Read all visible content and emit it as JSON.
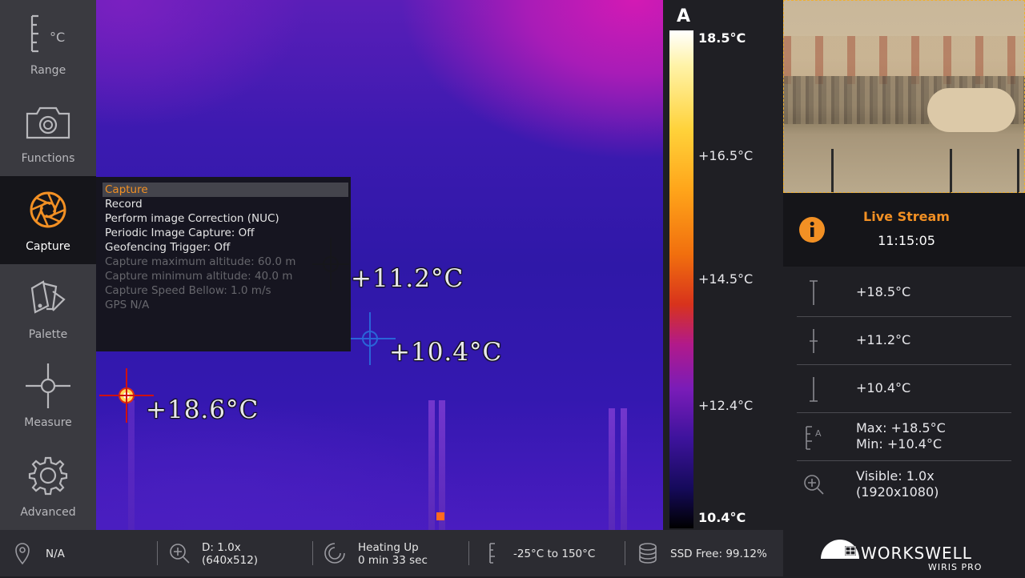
{
  "sidebar": {
    "items": [
      {
        "label": "Range",
        "icon": "thermometer-range-icon"
      },
      {
        "label": "Functions",
        "icon": "camera-icon"
      },
      {
        "label": "Capture",
        "icon": "aperture-icon",
        "active": true
      },
      {
        "label": "Palette",
        "icon": "palette-swatches-icon"
      },
      {
        "label": "Measure",
        "icon": "crosshair-icon"
      },
      {
        "label": "Advanced",
        "icon": "gear-icon"
      }
    ],
    "range_unit": "°C"
  },
  "capture_menu": {
    "items": [
      {
        "label": "Capture",
        "state": "selected"
      },
      {
        "label": "Record",
        "state": "normal"
      },
      {
        "label": "Perform image Correction (NUC)",
        "state": "normal"
      },
      {
        "label": "Periodic Image Capture: Off",
        "state": "normal"
      },
      {
        "label": "Geofencing Trigger: Off",
        "state": "normal"
      },
      {
        "label": "Capture maximum altitude: 60.0 m",
        "state": "disabled"
      },
      {
        "label": "Capture minimum altitude: 40.0 m",
        "state": "disabled"
      },
      {
        "label": "Capture Speed Bellow: 1.0 m/s",
        "state": "disabled"
      },
      {
        "label": "GPS N/A",
        "state": "disabled"
      }
    ]
  },
  "markers": {
    "center": "+11.2°C",
    "min": "+10.4°C",
    "max": "+18.6°C"
  },
  "scale": {
    "mode": "A",
    "labels": [
      "18.5°C",
      "+16.5°C",
      "+14.5°C",
      "+12.4°C",
      "10.4°C"
    ]
  },
  "live_stream": {
    "title": "Live Stream",
    "time": "11:15:05"
  },
  "measurements": {
    "max_value": "+18.5°C",
    "center_value": "+11.2°C",
    "min_value": "+10.4°C",
    "range_max": "Max: +18.5°C",
    "range_min": "Min: +10.4°C",
    "visible_zoom": "Visible: 1.0x",
    "visible_resolution": "(1920x1080)"
  },
  "bottom_bar": {
    "gps": "N/A",
    "digital_zoom": "D: 1.0x",
    "thermal_resolution": "(640x512)",
    "status": "Heating Up",
    "status_time": "0 min 33 sec",
    "temp_range": "-25°C to 150°C",
    "ssd": "SSD Free: 99.12%"
  },
  "brand": {
    "name": "WORKSWELL",
    "product": "WIRIS PRO"
  },
  "colors": {
    "accent": "#f29024",
    "active_sidebar": "#15151a",
    "sidebar": "#3a3a40"
  }
}
